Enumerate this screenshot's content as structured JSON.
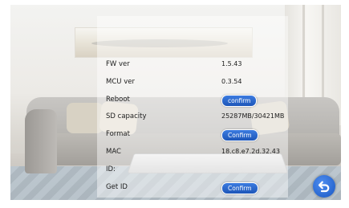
{
  "settings": {
    "fw_ver": {
      "label": "FW ver",
      "value": "1.5.43"
    },
    "mcu_ver": {
      "label": "MCU ver",
      "value": "0.3.54"
    },
    "reboot": {
      "label": "Reboot",
      "button": "confirm"
    },
    "sd_capacity": {
      "label": "SD capacity",
      "value": "25287MB/30421MB"
    },
    "format": {
      "label": "Format",
      "button": "Confirm"
    },
    "mac": {
      "label": "MAC",
      "value": "18.c8.e7.2d.32.43"
    },
    "id": {
      "label": "ID:"
    },
    "get_id": {
      "label": "Get ID",
      "button": "Confirm"
    }
  },
  "icons": {
    "back": "back-arrow-icon"
  },
  "colors": {
    "button_blue": "#1d56b8",
    "back_button_blue": "#2f6fe0"
  }
}
